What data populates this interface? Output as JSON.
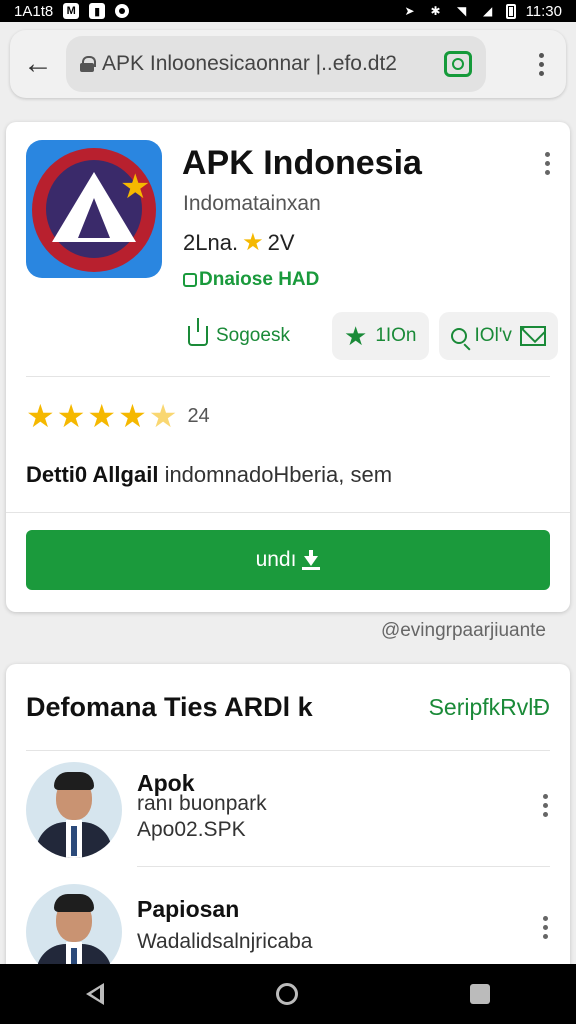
{
  "status_bar": {
    "left_text": "1A1t8",
    "left_square_icon": "M",
    "time": "11:30"
  },
  "toolbar": {
    "url": "APK Inloonesicaonnar |..efo.dt2"
  },
  "app": {
    "title": "APK Indonesia",
    "subtitle": "Indomatainxan",
    "rating_prefix": "2Lna.",
    "rating_suffix": "2V",
    "badge": "Dnaiose HAD",
    "actions": {
      "share_label": "Sogoesk",
      "star_label": "1IOn",
      "search_label": "IOl'v"
    },
    "star_rating": 4.5,
    "rating_count": "24",
    "developer_label": "Detti0 Allgail",
    "developer_name": "indomnadoHberia, sem",
    "install_label": "undı"
  },
  "footer_note": "@evingrpaarjiuante",
  "developers_section": {
    "title": "Defomana Ties ARDl k",
    "link": "SeripfkRvlĐ",
    "people": [
      {
        "name": "Apok",
        "line1": "ranı buonpark",
        "line2": "Apo02.SPK"
      },
      {
        "name": "Papiosan",
        "line1": "Wadalidsalnjricaba",
        "line2": ""
      }
    ]
  },
  "colors": {
    "accent_green": "#1b9a3c",
    "star_yellow": "#f5b800",
    "status_bar": "#000000"
  },
  "icons": [
    "back-arrow-icon",
    "lock-icon",
    "tab-switcher-icon",
    "more-vert-icon",
    "share-icon",
    "star-icon",
    "search-icon",
    "mail-icon",
    "download-icon"
  ]
}
